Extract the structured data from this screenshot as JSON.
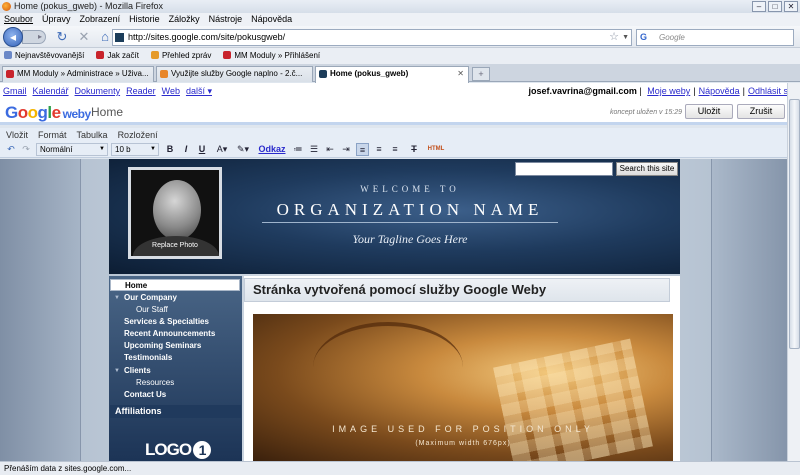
{
  "window": {
    "title": "Home (pokus_gweb) - Mozilla Firefox"
  },
  "menu": [
    "Soubor",
    "Úpravy",
    "Zobrazení",
    "Historie",
    "Záložky",
    "Nástroje",
    "Nápověda"
  ],
  "nav": {
    "url": "http://sites.google.com/site/pokusgweb/",
    "search_placeholder": "Google"
  },
  "bookmarks": [
    "Nejnavštěvovanější",
    "Jak začít",
    "Přehled zpráv",
    "MM Moduly » Přihlášení"
  ],
  "tabs": [
    {
      "label": "MM Moduly » Administrace » Uživa..."
    },
    {
      "label": "Využijte služby Google naplno - 2.č..."
    },
    {
      "label": "Home (pokus_gweb)"
    }
  ],
  "gbar": {
    "links": [
      "Gmail",
      "Kalendář",
      "Dokumenty",
      "Reader",
      "Web",
      "další ▾"
    ],
    "email": "josef.vavrina@gmail.com",
    "my_sites": "Moje weby",
    "help": "Nápověda",
    "sign_out": "Odhlásit se"
  },
  "header": {
    "logo_letters": [
      "G",
      "o",
      "o",
      "g",
      "l",
      "e"
    ],
    "logo_suffix": "weby",
    "page_title": "Home",
    "draft_saved": "koncept uložen v 15:29",
    "save": "Uložit",
    "cancel": "Zrušit"
  },
  "editor": {
    "menu": [
      "Vložit",
      "Formát",
      "Tabulka",
      "Rozložení"
    ],
    "style": "Normální",
    "size": "10 b",
    "bold": "B",
    "italic": "I",
    "underline": "U",
    "link": "Odkaz",
    "html": "HTML"
  },
  "site": {
    "search_button": "Search this site",
    "replace_photo": "Replace Photo",
    "welcome": "WELCOME TO",
    "org_name": "ORGANIZATION NAME",
    "tagline": "Your Tagline Goes Here",
    "nav": [
      {
        "label": "Home"
      },
      {
        "label": "Our Company"
      },
      {
        "label": "Our Staff"
      },
      {
        "label": "Services & Specialties"
      },
      {
        "label": "Recent Announcements"
      },
      {
        "label": "Upcoming Seminars"
      },
      {
        "label": "Testimonials"
      },
      {
        "label": "Clients"
      },
      {
        "label": "Resources"
      },
      {
        "label": "Contact Us"
      }
    ],
    "affiliations": "Affiliations",
    "logo_text": "LOGO",
    "logo_number": "1",
    "heading": "Stránka vytvořená pomocí služby Google Weby",
    "image_text": "IMAGE USED FOR POSITION ONLY",
    "image_subtext": "(Maximum width 676px)"
  },
  "status": "Přenáším data z sites.google.com..."
}
